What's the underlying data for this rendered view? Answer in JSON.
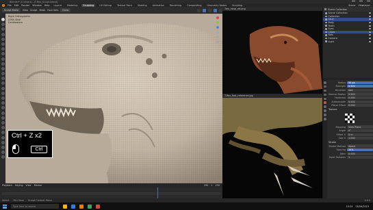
{
  "window": {
    "title": "Blender* [C:\\Users\\...\\T-Rex_Sculpt.blend]",
    "controls": [
      "minimize",
      "maximize",
      "close"
    ]
  },
  "menubar": {
    "items": [
      "File",
      "Edit",
      "Render",
      "Window",
      "Help"
    ],
    "workspaces": [
      "Layout",
      "Modeling",
      "Sculpting",
      "UV Editing",
      "Texture Paint",
      "Shading",
      "Animation",
      "Rendering",
      "Compositing",
      "Geometry Nodes",
      "Scripting"
    ],
    "active_workspace": "Sculpting",
    "scene": "Scene",
    "view_layer": "ViewLayer"
  },
  "header3d": {
    "mode": "Sculpt Mode",
    "menus": [
      "View",
      "Sculpt",
      "Mask",
      "Face Sets"
    ],
    "brush": "Draw"
  },
  "viewport": {
    "info_lines": [
      "Right Orthographic",
      "(290) Skull",
      "Centimeters"
    ],
    "gizmo_colors": [
      "#e0415a",
      "#8ac43c",
      "#4f86e8",
      "#a8a8a8"
    ]
  },
  "shortcut_overlay": {
    "keys_text": "Ctrl + Z x2",
    "ctrl_label": "Ctrl",
    "mouse_icon": "mouse-left-click-icon"
  },
  "timeline": {
    "menus": [
      "Playback",
      "Keying",
      "View",
      "Marker"
    ],
    "current_frame": "290",
    "start": "1",
    "end": "250"
  },
  "reference_top": {
    "title": "Trex_head_ref.png"
  },
  "reference_bottom": {
    "title": "T-Rex_foot_reference.jpg"
  },
  "outliner": {
    "title": "Scene Collection",
    "rows": [
      {
        "label": "Scene Collection",
        "selected": false
      },
      {
        "label": "Collection",
        "selected": false
      },
      {
        "label": "Skull",
        "selected": true
      },
      {
        "label": "Body",
        "selected": false
      },
      {
        "label": "Teeth",
        "selected": false
      },
      {
        "label": "Eyes",
        "selected": false
      },
      {
        "label": "Claws",
        "selected": true
      },
      {
        "label": "Refs",
        "selected": false
      },
      {
        "label": "Camera",
        "selected": false
      },
      {
        "label": "Light",
        "selected": false
      }
    ]
  },
  "properties": {
    "rows": [
      {
        "label": "Radius",
        "value": "50 px",
        "style": "blue"
      },
      {
        "label": "Strength",
        "value": "0.500",
        "style": "blue"
      },
      {
        "label": "Direction",
        "value": "Add",
        "style": "gray"
      },
      {
        "label": "Normal Radius",
        "value": "0.500",
        "style": "gray"
      },
      {
        "label": "Hardness",
        "value": "0.000",
        "style": "gray"
      },
      {
        "label": "Autosmooth",
        "value": "0.000",
        "style": "gray"
      },
      {
        "label": "Plane Offset",
        "value": "0.000",
        "style": "gray"
      }
    ],
    "section_texture": "Texture",
    "section_stroke": "Stroke",
    "texture_rows": [
      {
        "label": "Mapping",
        "value": "View Plane",
        "style": "gray"
      },
      {
        "label": "Angle",
        "value": "0°",
        "style": "gray"
      },
      {
        "label": "Offset X",
        "value": "0 m",
        "style": "gray"
      },
      {
        "label": "Size X",
        "value": "1.000",
        "style": "gray"
      }
    ],
    "stroke_rows": [
      {
        "label": "Stroke Method",
        "value": "Space",
        "style": "gray"
      },
      {
        "label": "Spacing",
        "value": "10%",
        "style": "blue"
      },
      {
        "label": "Jitter",
        "value": "0.000",
        "style": "gray"
      },
      {
        "label": "Input Samples",
        "value": "1",
        "style": "gray"
      }
    ]
  },
  "statusbar": {
    "hints": [
      "Select",
      "Pan View",
      "Sculpt Context Menu"
    ],
    "version": "3.6.0"
  },
  "taskbar": {
    "search_placeholder": "Type here to search",
    "time": "10:24",
    "date": "05/06/2023",
    "app_colors": [
      "#f5b400",
      "#2d7de2",
      "#e87d0d",
      "#3ba55d",
      "#d34836"
    ]
  }
}
